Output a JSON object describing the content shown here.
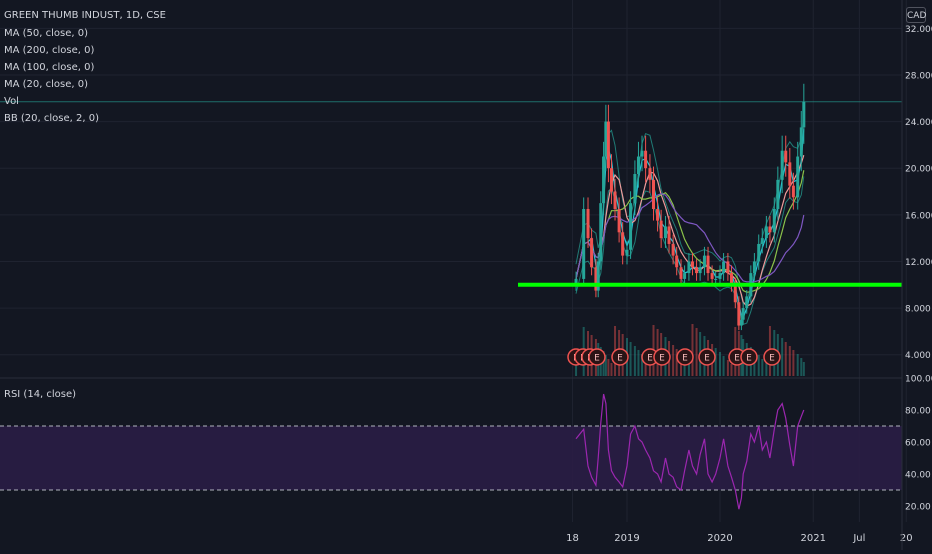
{
  "legend": {
    "title": "GREEN THUMB INDUST, 1D, CSE",
    "indicators": [
      "MA (50, close, 0)",
      "MA (200, close, 0)",
      "MA (100, close, 0)",
      "MA (20, close, 0)",
      "Vol",
      "BB (20, close, 2, 0)"
    ],
    "rsi": "RSI (14, close)"
  },
  "currency": "CAD",
  "colors": {
    "background": "#131722",
    "grid": "#1f2330",
    "text": "#d1d4dc",
    "up": "#26a69a",
    "down": "#ef5350",
    "support_line": "#00ff00",
    "rsi": "#9c27b0",
    "rsi_band": "#2a1d45",
    "bb": "#26a69a",
    "ma50": "#ef9a9a",
    "ma200": "#7e57c2",
    "ma100": "#8bc34a",
    "ma20": "#26c6da"
  },
  "chart_data": [
    {
      "type": "candlestick",
      "title": "GREEN THUMB INDUST, 1D, CSE",
      "ylabel": "CAD",
      "x_ticks": [
        "18",
        "2019",
        "2020",
        "2021",
        "Jul",
        "20"
      ],
      "y_ticks": [
        "4.000",
        "8.000",
        "12.000",
        "16.000",
        "20.000",
        "24.000",
        "28.000",
        "32.000"
      ],
      "ylim": [
        2,
        34
      ],
      "horizontal_lines": [
        {
          "value": 10.0,
          "color": "#00ff00"
        },
        {
          "value": 25.7,
          "color": "#26a69a"
        }
      ],
      "price_series": {
        "x": [
          "2018-06-15",
          "2018-07-15",
          "2018-08-01",
          "2018-08-15",
          "2018-09-01",
          "2018-09-10",
          "2018-09-20",
          "2018-10-01",
          "2018-10-10",
          "2018-10-20",
          "2018-11-01",
          "2018-11-15",
          "2018-12-01",
          "2018-12-15",
          "2019-01-01",
          "2019-01-15",
          "2019-02-01",
          "2019-02-15",
          "2019-03-01",
          "2019-03-15",
          "2019-04-01",
          "2019-04-15",
          "2019-05-01",
          "2019-05-15",
          "2019-06-01",
          "2019-06-15",
          "2019-07-01",
          "2019-07-15",
          "2019-08-01",
          "2019-08-15",
          "2019-09-01",
          "2019-09-15",
          "2019-10-01",
          "2019-10-15",
          "2019-11-01",
          "2019-11-15",
          "2019-12-01",
          "2019-12-15",
          "2020-01-01",
          "2020-01-15",
          "2020-02-01",
          "2020-02-15",
          "2020-03-01",
          "2020-03-15",
          "2020-03-25",
          "2020-04-01",
          "2020-04-15",
          "2020-05-01",
          "2020-05-15",
          "2020-06-01",
          "2020-06-15",
          "2020-07-01",
          "2020-07-15",
          "2020-08-01",
          "2020-08-15",
          "2020-09-01",
          "2020-09-15",
          "2020-10-01",
          "2020-10-15",
          "2020-11-01",
          "2020-11-15",
          "2020-11-25"
        ],
        "close": [
          10.5,
          16.5,
          14.0,
          11.5,
          9.5,
          12.0,
          17.0,
          21.0,
          24.0,
          20.0,
          18.0,
          16.5,
          14.5,
          12.5,
          13.0,
          17.0,
          19.5,
          21.0,
          21.5,
          20.0,
          19.0,
          16.5,
          15.5,
          14.0,
          15.0,
          13.5,
          12.5,
          11.5,
          10.5,
          11.0,
          12.0,
          11.5,
          11.0,
          11.5,
          12.5,
          11.0,
          10.5,
          10.5,
          11.0,
          12.0,
          11.0,
          10.0,
          8.5,
          6.5,
          7.0,
          8.0,
          9.0,
          11.0,
          12.0,
          13.5,
          14.0,
          15.0,
          14.5,
          16.5,
          19.0,
          21.5,
          20.5,
          18.5,
          17.5,
          21.0,
          23.5,
          25.7
        ]
      },
      "volume_note": "Volume histogram along bottom of price pane",
      "event_markers": [
        "E",
        "E",
        "E",
        "E",
        "E",
        "E",
        "E",
        "E",
        "E",
        "E",
        "E",
        "E"
      ]
    },
    {
      "type": "line",
      "title": "RSI (14, close)",
      "y_ticks": [
        "20.00",
        "40.00",
        "60.00",
        "80.00",
        "100.00"
      ],
      "ylim": [
        10,
        100
      ],
      "overbought": 70,
      "oversold": 30,
      "series": [
        {
          "name": "RSI (14, close)",
          "x": [
            "2018-06-15",
            "2018-07-15",
            "2018-08-01",
            "2018-08-15",
            "2018-09-01",
            "2018-09-10",
            "2018-09-20",
            "2018-10-01",
            "2018-10-10",
            "2018-10-20",
            "2018-11-01",
            "2018-11-15",
            "2018-12-01",
            "2018-12-15",
            "2019-01-01",
            "2019-01-15",
            "2019-02-01",
            "2019-02-15",
            "2019-03-01",
            "2019-03-15",
            "2019-04-01",
            "2019-04-15",
            "2019-05-01",
            "2019-05-15",
            "2019-06-01",
            "2019-06-15",
            "2019-07-01",
            "2019-07-15",
            "2019-08-01",
            "2019-08-15",
            "2019-09-01",
            "2019-09-15",
            "2019-10-01",
            "2019-10-15",
            "2019-11-01",
            "2019-11-15",
            "2019-12-01",
            "2019-12-15",
            "2020-01-01",
            "2020-01-15",
            "2020-02-01",
            "2020-02-15",
            "2020-03-01",
            "2020-03-15",
            "2020-03-25",
            "2020-04-01",
            "2020-04-15",
            "2020-05-01",
            "2020-05-15",
            "2020-06-01",
            "2020-06-15",
            "2020-07-01",
            "2020-07-15",
            "2020-08-01",
            "2020-08-15",
            "2020-09-01",
            "2020-09-15",
            "2020-10-01",
            "2020-10-15",
            "2020-11-01",
            "2020-11-15",
            "2020-11-25"
          ],
          "values": [
            62,
            68,
            45,
            38,
            33,
            50,
            72,
            90,
            84,
            55,
            42,
            38,
            35,
            32,
            45,
            65,
            70,
            62,
            60,
            55,
            50,
            42,
            40,
            35,
            50,
            40,
            38,
            32,
            30,
            42,
            55,
            45,
            40,
            52,
            62,
            40,
            35,
            40,
            50,
            62,
            45,
            38,
            30,
            18,
            25,
            40,
            48,
            65,
            60,
            70,
            55,
            60,
            50,
            68,
            80,
            84,
            75,
            58,
            45,
            70,
            76,
            80
          ]
        }
      ]
    }
  ]
}
